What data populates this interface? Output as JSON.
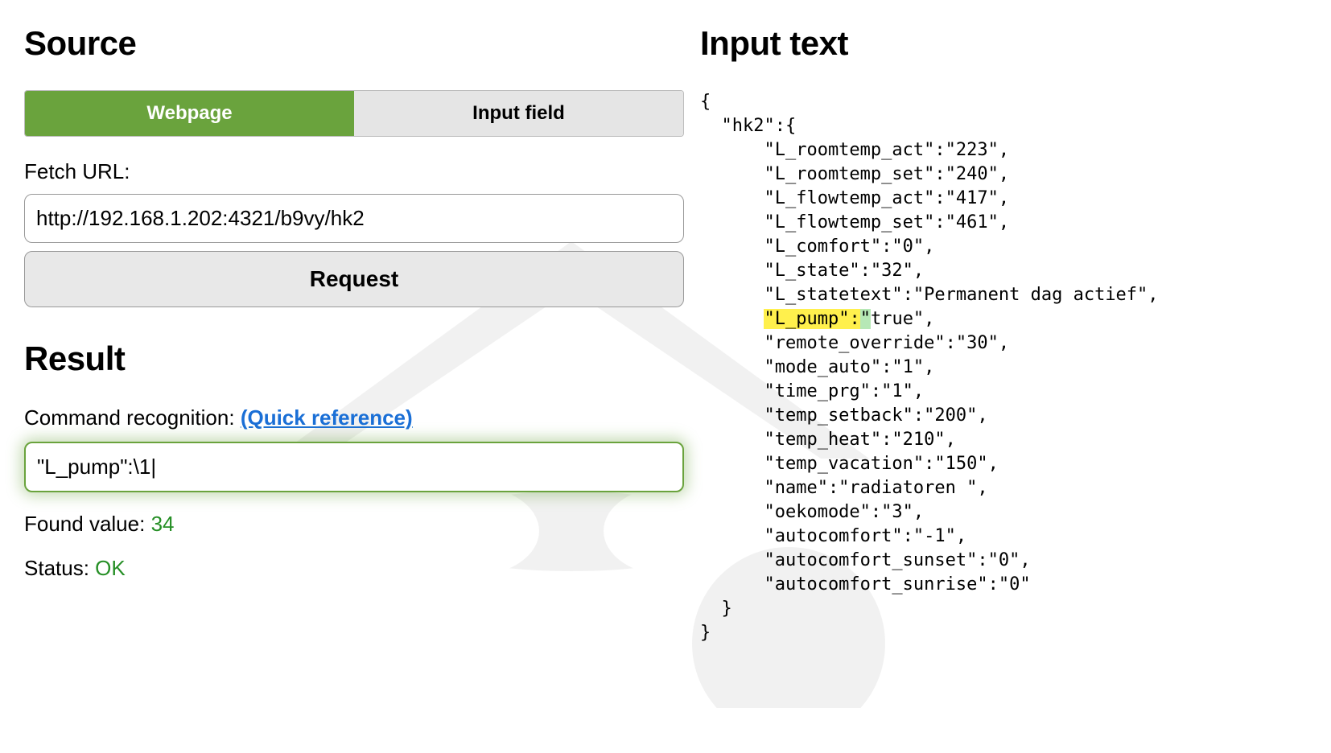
{
  "source": {
    "heading": "Source",
    "tabs": {
      "webpage": "Webpage",
      "inputfield": "Input field"
    },
    "fetch_label": "Fetch URL:",
    "fetch_url": "http://192.168.1.202:4321/b9vy/hk2",
    "request_label": "Request"
  },
  "result": {
    "heading": "Result",
    "cr_label": "Command recognition: ",
    "cr_link": "(Quick reference)",
    "regex_value": "\"L_pump\":\\1|",
    "found_label": "Found value: ",
    "found_value": "34",
    "status_label": "Status: ",
    "status_value": "OK"
  },
  "input_text": {
    "heading": "Input text",
    "lines": [
      {
        "t": "{"
      },
      {
        "t": "  \"hk2\":{"
      },
      {
        "t": "      \"L_roomtemp_act\":\"223\","
      },
      {
        "t": "      \"L_roomtemp_set\":\"240\","
      },
      {
        "t": "      \"L_flowtemp_act\":\"417\","
      },
      {
        "t": "      \"L_flowtemp_set\":\"461\","
      },
      {
        "t": "      \"L_comfort\":\"0\","
      },
      {
        "t": "      \"L_state\":\"32\","
      },
      {
        "t": "      \"L_statetext\":\"Permanent dag actief\","
      },
      {
        "pre": "      ",
        "hk": "\"L_pump\":",
        "hv": "\"",
        "post": "true\","
      },
      {
        "t": "      \"remote_override\":\"30\","
      },
      {
        "t": "      \"mode_auto\":\"1\","
      },
      {
        "t": "      \"time_prg\":\"1\","
      },
      {
        "t": "      \"temp_setback\":\"200\","
      },
      {
        "t": "      \"temp_heat\":\"210\","
      },
      {
        "t": "      \"temp_vacation\":\"150\","
      },
      {
        "t": "      \"name\":\"radiatoren \","
      },
      {
        "t": "      \"oekomode\":\"3\","
      },
      {
        "t": "      \"autocomfort\":\"-1\","
      },
      {
        "t": "      \"autocomfort_sunset\":\"0\","
      },
      {
        "t": "      \"autocomfort_sunrise\":\"0\""
      },
      {
        "t": "  }"
      },
      {
        "t": "}"
      }
    ]
  }
}
